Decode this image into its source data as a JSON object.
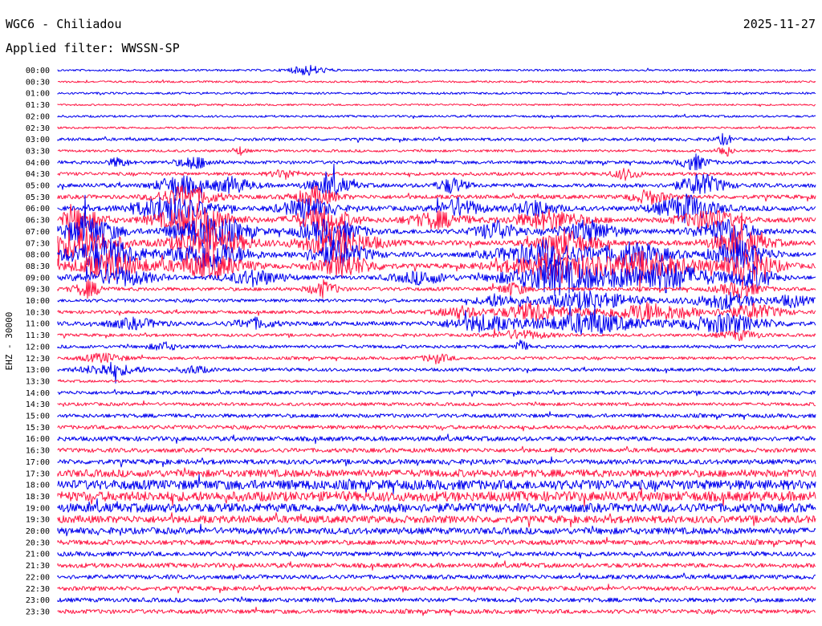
{
  "header": {
    "station": "WGC6 - Chiliadou",
    "date": "2025-11-27",
    "filter": "Applied filter: WWSSN-SP",
    "channel": "EHZ - 30000"
  },
  "colors": {
    "trace_even": "#0000ee",
    "trace_odd": "#ff1744",
    "background": "#ffffff",
    "text": "#000000"
  },
  "chart_data": {
    "type": "seismogram-helicorder",
    "trace_colors": [
      "blue",
      "red"
    ],
    "rows": [
      {
        "label": "00:00",
        "noise": 1.2,
        "events": [
          {
            "pos": 0.33,
            "amp": 7,
            "len": 0.05
          }
        ]
      },
      {
        "label": "00:30",
        "noise": 1.2,
        "events": []
      },
      {
        "label": "01:00",
        "noise": 1.3,
        "events": []
      },
      {
        "label": "01:30",
        "noise": 1.1,
        "events": []
      },
      {
        "label": "02:00",
        "noise": 1.3,
        "events": []
      },
      {
        "label": "02:30",
        "noise": 1.3,
        "events": []
      },
      {
        "label": "03:00",
        "noise": 1.8,
        "events": [
          {
            "pos": 0.88,
            "amp": 8,
            "len": 0.02
          }
        ]
      },
      {
        "label": "03:30",
        "noise": 1.5,
        "events": [
          {
            "pos": 0.24,
            "amp": 5,
            "len": 0.02
          },
          {
            "pos": 0.88,
            "amp": 9,
            "len": 0.02
          }
        ]
      },
      {
        "label": "04:00",
        "noise": 2.0,
        "events": [
          {
            "pos": 0.08,
            "amp": 6,
            "len": 0.03
          },
          {
            "pos": 0.18,
            "amp": 8,
            "len": 0.05
          },
          {
            "pos": 0.84,
            "amp": 10,
            "len": 0.04
          }
        ]
      },
      {
        "label": "04:30",
        "noise": 2.0,
        "events": [
          {
            "pos": 0.3,
            "amp": 6,
            "len": 0.04
          },
          {
            "pos": 0.75,
            "amp": 7,
            "len": 0.04
          }
        ]
      },
      {
        "label": "05:00",
        "noise": 2.5,
        "events": [
          {
            "pos": 0.16,
            "amp": 14,
            "len": 0.06
          },
          {
            "pos": 0.23,
            "amp": 10,
            "len": 0.06
          },
          {
            "pos": 0.36,
            "amp": 12,
            "len": 0.06
          },
          {
            "pos": 0.52,
            "amp": 10,
            "len": 0.04
          },
          {
            "pos": 0.85,
            "amp": 15,
            "len": 0.06
          }
        ]
      },
      {
        "label": "05:30",
        "noise": 2.5,
        "events": [
          {
            "pos": 0.17,
            "amp": 15,
            "len": 0.08
          },
          {
            "pos": 0.34,
            "amp": 12,
            "len": 0.06
          },
          {
            "pos": 0.78,
            "amp": 9,
            "len": 0.05
          }
        ]
      },
      {
        "label": "06:00",
        "noise": 3.0,
        "events": [
          {
            "pos": 0.15,
            "amp": 18,
            "len": 0.1
          },
          {
            "pos": 0.33,
            "amp": 14,
            "len": 0.07
          },
          {
            "pos": 0.53,
            "amp": 12,
            "len": 0.06
          },
          {
            "pos": 0.63,
            "amp": 10,
            "len": 0.06
          },
          {
            "pos": 0.83,
            "amp": 18,
            "len": 0.08
          }
        ]
      },
      {
        "label": "06:30",
        "noise": 3.0,
        "events": [
          {
            "pos": 0.03,
            "amp": 16,
            "len": 0.06
          },
          {
            "pos": 0.18,
            "amp": 20,
            "len": 0.1
          },
          {
            "pos": 0.35,
            "amp": 16,
            "len": 0.08
          },
          {
            "pos": 0.5,
            "amp": 10,
            "len": 0.08
          },
          {
            "pos": 0.65,
            "amp": 12,
            "len": 0.1
          },
          {
            "pos": 0.86,
            "amp": 14,
            "len": 0.08
          }
        ]
      },
      {
        "label": "07:00",
        "noise": 3.0,
        "events": [
          {
            "pos": 0.04,
            "amp": 20,
            "len": 0.08
          },
          {
            "pos": 0.2,
            "amp": 22,
            "len": 0.1
          },
          {
            "pos": 0.36,
            "amp": 18,
            "len": 0.08
          },
          {
            "pos": 0.58,
            "amp": 12,
            "len": 0.06
          },
          {
            "pos": 0.7,
            "amp": 14,
            "len": 0.08
          },
          {
            "pos": 0.88,
            "amp": 16,
            "len": 0.08
          }
        ]
      },
      {
        "label": "07:30",
        "noise": 3.0,
        "events": [
          {
            "pos": 0.03,
            "amp": 22,
            "len": 0.1
          },
          {
            "pos": 0.2,
            "amp": 22,
            "len": 0.1
          },
          {
            "pos": 0.37,
            "amp": 20,
            "len": 0.1
          },
          {
            "pos": 0.67,
            "amp": 16,
            "len": 0.08
          },
          {
            "pos": 0.9,
            "amp": 16,
            "len": 0.08
          }
        ]
      },
      {
        "label": "08:00",
        "noise": 3.0,
        "events": [
          {
            "pos": 0.06,
            "amp": 22,
            "len": 0.1
          },
          {
            "pos": 0.2,
            "amp": 20,
            "len": 0.1
          },
          {
            "pos": 0.37,
            "amp": 18,
            "len": 0.08
          },
          {
            "pos": 0.64,
            "amp": 18,
            "len": 0.12
          },
          {
            "pos": 0.76,
            "amp": 16,
            "len": 0.1
          },
          {
            "pos": 0.9,
            "amp": 18,
            "len": 0.08
          }
        ]
      },
      {
        "label": "08:30",
        "noise": 3.0,
        "events": [
          {
            "pos": 0.07,
            "amp": 18,
            "len": 0.1
          },
          {
            "pos": 0.2,
            "amp": 16,
            "len": 0.1
          },
          {
            "pos": 0.38,
            "amp": 14,
            "len": 0.08
          },
          {
            "pos": 0.66,
            "amp": 20,
            "len": 0.14
          },
          {
            "pos": 0.78,
            "amp": 18,
            "len": 0.12
          },
          {
            "pos": 0.91,
            "amp": 20,
            "len": 0.08
          }
        ]
      },
      {
        "label": "09:00",
        "noise": 2.5,
        "events": [
          {
            "pos": 0.08,
            "amp": 12,
            "len": 0.1
          },
          {
            "pos": 0.26,
            "amp": 10,
            "len": 0.08
          },
          {
            "pos": 0.48,
            "amp": 8,
            "len": 0.08
          },
          {
            "pos": 0.66,
            "amp": 22,
            "len": 0.14
          },
          {
            "pos": 0.8,
            "amp": 20,
            "len": 0.14
          },
          {
            "pos": 0.92,
            "amp": 14,
            "len": 0.06
          }
        ]
      },
      {
        "label": "09:30",
        "noise": 2.2,
        "events": [
          {
            "pos": 0.04,
            "amp": 10,
            "len": 0.04
          },
          {
            "pos": 0.35,
            "amp": 10,
            "len": 0.04
          },
          {
            "pos": 0.6,
            "amp": 8,
            "len": 0.04
          },
          {
            "pos": 0.9,
            "amp": 10,
            "len": 0.06
          }
        ]
      },
      {
        "label": "10:00",
        "noise": 2.0,
        "events": [
          {
            "pos": 0.58,
            "amp": 8,
            "len": 0.06
          },
          {
            "pos": 0.7,
            "amp": 12,
            "len": 0.14
          },
          {
            "pos": 0.88,
            "amp": 10,
            "len": 0.1
          },
          {
            "pos": 0.97,
            "amp": 8,
            "len": 0.05
          }
        ]
      },
      {
        "label": "10:30",
        "noise": 2.0,
        "events": [
          {
            "pos": 0.53,
            "amp": 8,
            "len": 0.06
          },
          {
            "pos": 0.63,
            "amp": 12,
            "len": 0.1
          },
          {
            "pos": 0.78,
            "amp": 12,
            "len": 0.14
          },
          {
            "pos": 0.92,
            "amp": 10,
            "len": 0.08
          }
        ]
      },
      {
        "label": "11:00",
        "noise": 2.5,
        "events": [
          {
            "pos": 0.1,
            "amp": 6,
            "len": 0.08
          },
          {
            "pos": 0.26,
            "amp": 6,
            "len": 0.06
          },
          {
            "pos": 0.56,
            "amp": 10,
            "len": 0.1
          },
          {
            "pos": 0.7,
            "amp": 14,
            "len": 0.14
          },
          {
            "pos": 0.88,
            "amp": 12,
            "len": 0.12
          }
        ]
      },
      {
        "label": "11:30",
        "noise": 1.8,
        "events": [
          {
            "pos": 0.61,
            "amp": 6,
            "len": 0.08
          },
          {
            "pos": 0.9,
            "amp": 6,
            "len": 0.06
          }
        ]
      },
      {
        "label": "12:00",
        "noise": 2.0,
        "events": [
          {
            "pos": 0.14,
            "amp": 5,
            "len": 0.04
          },
          {
            "pos": 0.61,
            "amp": 8,
            "len": 0.02
          }
        ]
      },
      {
        "label": "12:30",
        "noise": 1.8,
        "events": [
          {
            "pos": 0.06,
            "amp": 6,
            "len": 0.06
          },
          {
            "pos": 0.5,
            "amp": 6,
            "len": 0.04
          }
        ]
      },
      {
        "label": "13:00",
        "noise": 2.0,
        "events": [
          {
            "pos": 0.07,
            "amp": 8,
            "len": 0.08
          },
          {
            "pos": 0.18,
            "amp": 5,
            "len": 0.04
          }
        ]
      },
      {
        "label": "13:30",
        "noise": 1.5,
        "events": []
      },
      {
        "label": "14:00",
        "noise": 2.2,
        "events": []
      },
      {
        "label": "14:30",
        "noise": 2.0,
        "events": []
      },
      {
        "label": "15:00",
        "noise": 2.4,
        "events": []
      },
      {
        "label": "15:30",
        "noise": 2.4,
        "events": []
      },
      {
        "label": "16:00",
        "noise": 2.8,
        "events": []
      },
      {
        "label": "16:30",
        "noise": 2.6,
        "events": []
      },
      {
        "label": "17:00",
        "noise": 3.0,
        "events": []
      },
      {
        "label": "17:30",
        "noise": 4.5,
        "events": []
      },
      {
        "label": "18:00",
        "noise": 6.0,
        "events": []
      },
      {
        "label": "18:30",
        "noise": 6.0,
        "events": []
      },
      {
        "label": "19:00",
        "noise": 5.5,
        "events": []
      },
      {
        "label": "19:30",
        "noise": 4.5,
        "events": []
      },
      {
        "label": "20:00",
        "noise": 4.0,
        "events": []
      },
      {
        "label": "20:30",
        "noise": 3.0,
        "events": []
      },
      {
        "label": "21:00",
        "noise": 2.8,
        "events": []
      },
      {
        "label": "21:30",
        "noise": 2.8,
        "events": []
      },
      {
        "label": "22:00",
        "noise": 2.6,
        "events": []
      },
      {
        "label": "22:30",
        "noise": 2.6,
        "events": []
      },
      {
        "label": "23:00",
        "noise": 2.6,
        "events": []
      },
      {
        "label": "23:30",
        "noise": 2.6,
        "events": []
      }
    ]
  }
}
